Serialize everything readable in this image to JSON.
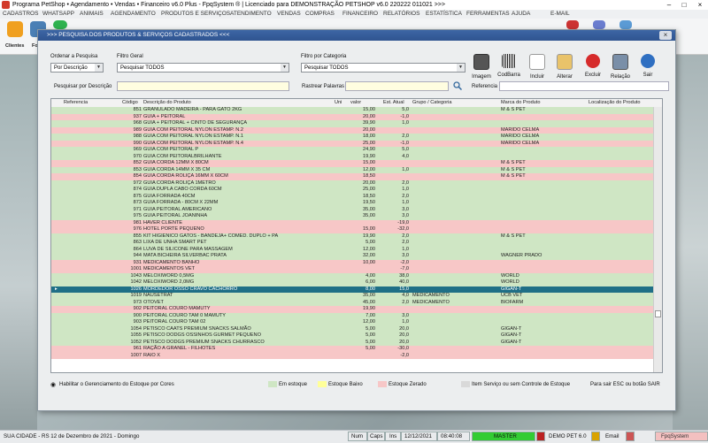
{
  "app": {
    "title": "Programa PetShop • Agendamento • Vendas • Financeiro v6.0 Plus - FpqSystem ® | Licenciado para  DEMONSTRAÇÃO PETSHOP v6.0 220222 011021 >>>"
  },
  "menu": [
    "CADASTROS",
    "WHATSAPP",
    "ANIMAIS",
    "AGENDAMENTO",
    "PRODUTOS E SERVIÇOS",
    "ATENDIMENTO",
    "VENDAS",
    "COMPRAS",
    "FINANCEIRO",
    "RELATÓRIOS",
    "ESTATÍSTICA",
    "FERRAMENTAS",
    "AJUDA",
    "E-MAIL"
  ],
  "toolbar": {
    "labels": [
      "Clientes",
      "Fo"
    ]
  },
  "dialog": {
    "title": ">>>  PESQUISA DOS PRODUTOS & SERVIÇOS CADASTRADOS  <<<",
    "ordenar_label": "Ordenar a Pesquisa",
    "ordenar_value": "Por Descrição",
    "filtro_geral_label": "Filtro Geral",
    "filtro_geral_value": "Pesquisar TODOS",
    "filtro_categoria_label": "Filtro por Categoria",
    "filtro_categoria_value": "Pesquisar TODOS",
    "pesquisar_desc_label": "Pesquisar por Descrição",
    "rastrear_label": "Rastrear Palavras",
    "referencia_label": "Referencia",
    "actions": [
      "Imagem",
      "CodBarra",
      "Incluir",
      "Alterar",
      "Excluir",
      "Relação",
      "Sair"
    ]
  },
  "table": {
    "columns": [
      "Referencia",
      "Código",
      "Descrição do Produto",
      "Uni",
      "valor",
      "Est. Atual",
      "Grupo / Categoria",
      "Marca do Produto",
      "Localização do Produto"
    ],
    "rows": [
      {
        "codigo": "851",
        "desc": "GRANULADO MADEIRA - PARA GATO 2KG",
        "valor": "15,00",
        "est": "5,0",
        "grupo": "",
        "marca": "M & S PET",
        "s": "g"
      },
      {
        "codigo": "937",
        "desc": "GUIA + PEITORAL",
        "valor": "20,00",
        "est": "-1,0",
        "grupo": "",
        "marca": "",
        "s": "r"
      },
      {
        "codigo": "968",
        "desc": "GUIA + PEITORAL + CINTO DE SEGURANÇA",
        "valor": "39,90",
        "est": "1,0",
        "grupo": "",
        "marca": "",
        "s": "g"
      },
      {
        "codigo": "989",
        "desc": "GUIA COM PEITORAL NYLON ESTAMP. N.2",
        "valor": "20,00",
        "est": "",
        "grupo": "",
        "marca": "MARIDO CELMA",
        "s": "r"
      },
      {
        "codigo": "988",
        "desc": "GUIA COM PEITORAL NYLON ESTAMP. N.1",
        "valor": "18,00",
        "est": "2,0",
        "grupo": "",
        "marca": "MARIDO CELMA",
        "s": "g"
      },
      {
        "codigo": "990",
        "desc": "GUIA COM PEITORAL NYLON ESTAMP. N.4",
        "valor": "25,00",
        "est": "-1,0",
        "grupo": "",
        "marca": "MARIDO CELMA",
        "s": "r"
      },
      {
        "codigo": "969",
        "desc": "GUIA COM PEITORAL P",
        "valor": "24,90",
        "est": "5,0",
        "grupo": "",
        "marca": "",
        "s": "g"
      },
      {
        "codigo": "970",
        "desc": "GUIA COM PEITORALBRILHANTE",
        "valor": "19,90",
        "est": "4,0",
        "grupo": "",
        "marca": "",
        "s": "g"
      },
      {
        "codigo": "852",
        "desc": "GUIA CORDA  12MM X 80CM",
        "valor": "15,00",
        "est": "",
        "grupo": "",
        "marca": "M & S PET",
        "s": "r"
      },
      {
        "codigo": "853",
        "desc": "GUIA CORDA 14MM X 35 CM",
        "valor": "12,00",
        "est": "1,0",
        "grupo": "",
        "marca": "M & S PET",
        "s": "g"
      },
      {
        "codigo": "854",
        "desc": "GUIA CORDA ROLIÇA   16MM X   60CM",
        "valor": "18,50",
        "est": "",
        "grupo": "",
        "marca": "M & S PET",
        "s": "r"
      },
      {
        "codigo": "972",
        "desc": "GUIA CORDA ROLIÇA  1METRO",
        "valor": "20,00",
        "est": "2,0",
        "grupo": "",
        "marca": "",
        "s": "g"
      },
      {
        "codigo": "874",
        "desc": "GUIA DUPLA CABO CORDA   60CM",
        "valor": "25,00",
        "est": "1,0",
        "grupo": "",
        "marca": "",
        "s": "g"
      },
      {
        "codigo": "875",
        "desc": "GUIA FORRADA  40CM",
        "valor": "18,50",
        "est": "2,0",
        "grupo": "",
        "marca": "",
        "s": "g"
      },
      {
        "codigo": "873",
        "desc": "GUIA FORRADA - 80CM X 22MM",
        "valor": "19,50",
        "est": "1,0",
        "grupo": "",
        "marca": "",
        "s": "g"
      },
      {
        "codigo": "971",
        "desc": "GUIA PEITORAL AMERICANO",
        "valor": "35,00",
        "est": "3,0",
        "grupo": "",
        "marca": "",
        "s": "g"
      },
      {
        "codigo": "975",
        "desc": "GUIA PEITORAL JOANINHA",
        "valor": "35,00",
        "est": "3,0",
        "grupo": "",
        "marca": "",
        "s": "g"
      },
      {
        "codigo": "981",
        "desc": "HAVER CLIENTE",
        "valor": "",
        "est": "-19,0",
        "grupo": "",
        "marca": "",
        "s": "r"
      },
      {
        "codigo": "976",
        "desc": "HOTEL PORTE PEQUENO",
        "valor": "15,00",
        "est": "-32,0",
        "grupo": "",
        "marca": "",
        "s": "r"
      },
      {
        "codigo": "855",
        "desc": "KIT HIGIENICO GATOS - BANDEJA+ COMED. DUPLO + PA",
        "valor": "19,90",
        "est": "2,0",
        "grupo": "",
        "marca": "M & S PET",
        "s": "g"
      },
      {
        "codigo": "863",
        "desc": "LIXA DE UNHA SMART PET",
        "valor": "5,00",
        "est": "2,0",
        "grupo": "",
        "marca": "",
        "s": "g"
      },
      {
        "codigo": "864",
        "desc": "LUVA DE SILICONE PARA MASSAGEM",
        "valor": "12,00",
        "est": "1,0",
        "grupo": "",
        "marca": "",
        "s": "g"
      },
      {
        "codigo": "944",
        "desc": "MATA BICHEIRA SILVERBAC PRATA",
        "valor": "32,00",
        "est": "3,0",
        "grupo": "",
        "marca": "WAGNER PRADO",
        "s": "g"
      },
      {
        "codigo": "931",
        "desc": "MEDICAMENTO BANHO",
        "valor": "10,00",
        "est": "-2,0",
        "grupo": "",
        "marca": "",
        "s": "r"
      },
      {
        "codigo": "1001",
        "desc": "MEDICAMENTOS VET",
        "valor": "",
        "est": "-7,0",
        "grupo": "",
        "marca": "",
        "s": "r"
      },
      {
        "codigo": "1043",
        "desc": "MELOXIWORD  0,5MG",
        "valor": "4,00",
        "est": "38,0",
        "grupo": "",
        "marca": "WORLD",
        "s": "g"
      },
      {
        "codigo": "1042",
        "desc": "MELOXIWORD 2,0MG",
        "valor": "6,00",
        "est": "40,0",
        "grupo": "",
        "marca": "WORLD",
        "s": "g"
      },
      {
        "codigo": "1026",
        "desc": "MORDEDOR OSSO CRAVO CACHORRO",
        "valor": "8,00",
        "est": "15,0",
        "grupo": "",
        "marca": "GIGAN-T",
        "s": "sel"
      },
      {
        "codigo": "1019",
        "desc": "NAUSETRAT",
        "valor": "35,00",
        "est": "4,0",
        "grupo": "MEDICAMENTO",
        "marca": "UCB VET",
        "s": "g"
      },
      {
        "codigo": "973",
        "desc": "OTOVET",
        "valor": "45,00",
        "est": "2,0",
        "grupo": "MEDICAMENTO",
        "marca": "BIOFARM",
        "s": "g"
      },
      {
        "codigo": "902",
        "desc": "PEITORAL COURO MAMUTY",
        "valor": "19,90",
        "est": "",
        "grupo": "",
        "marca": "",
        "s": "r"
      },
      {
        "codigo": "900",
        "desc": "PEITORAL COURO TAM 0 MAMUTY",
        "valor": "7,00",
        "est": "3,0",
        "grupo": "",
        "marca": "",
        "s": "g"
      },
      {
        "codigo": "903",
        "desc": "PEITORAL COURO TAM 02",
        "valor": "12,00",
        "est": "1,0",
        "grupo": "",
        "marca": "",
        "s": "g"
      },
      {
        "codigo": "1054",
        "desc": "PETISCO CAATS PREMIUM SNACKS SALMÃO",
        "valor": "5,00",
        "est": "20,0",
        "grupo": "",
        "marca": "GIGAN-T",
        "s": "g"
      },
      {
        "codigo": "1055",
        "desc": "PETISCO DODGS OSSINHOS GURMET PEQUENO",
        "valor": "5,00",
        "est": "20,0",
        "grupo": "",
        "marca": "GIGAN-T",
        "s": "g"
      },
      {
        "codigo": "1052",
        "desc": "PETISCO DODGS PREMIUM SNACKS CHURRASCO",
        "valor": "5,00",
        "est": "20,0",
        "grupo": "",
        "marca": "GIGAN-T",
        "s": "g"
      },
      {
        "codigo": "961",
        "desc": "RAÇÃO A GRANEL - FILHOTES",
        "valor": "5,00",
        "est": "-30,0",
        "grupo": "",
        "marca": "",
        "s": "r"
      },
      {
        "codigo": "1007",
        "desc": "RAIO X",
        "valor": "",
        "est": "-2,0",
        "grupo": "",
        "marca": "",
        "s": "r"
      }
    ]
  },
  "legend": {
    "habilitar": "Habilitar o Gerenciamento do Estoque por Cores",
    "em_estoque": "Em estoque",
    "estoque_baixo": "Estoque Baixo",
    "estoque_zerado": "Estoque Zerado",
    "item_servico": "Item Serviço ou sem Controle de Estoque",
    "sair_hint": "Para sair ESC ou botão SAIR"
  },
  "statusbar": {
    "city": "SUA CIDADE - RS 12 de Dezembro de 2021 - Domingo",
    "num": "Num",
    "caps": "Caps",
    "ins": "Ins",
    "date": "12/12/2021",
    "time": "08:40:08",
    "master": "MASTER",
    "version": "DEMO PET 6.0",
    "email": "Email",
    "brand": "FpqSystem"
  },
  "colors": {
    "green": "#cfe6c4",
    "red": "#f7c7c7",
    "selected": "#1f6f86",
    "yellow": "#ffff99",
    "gray": "#d9d9d9"
  }
}
